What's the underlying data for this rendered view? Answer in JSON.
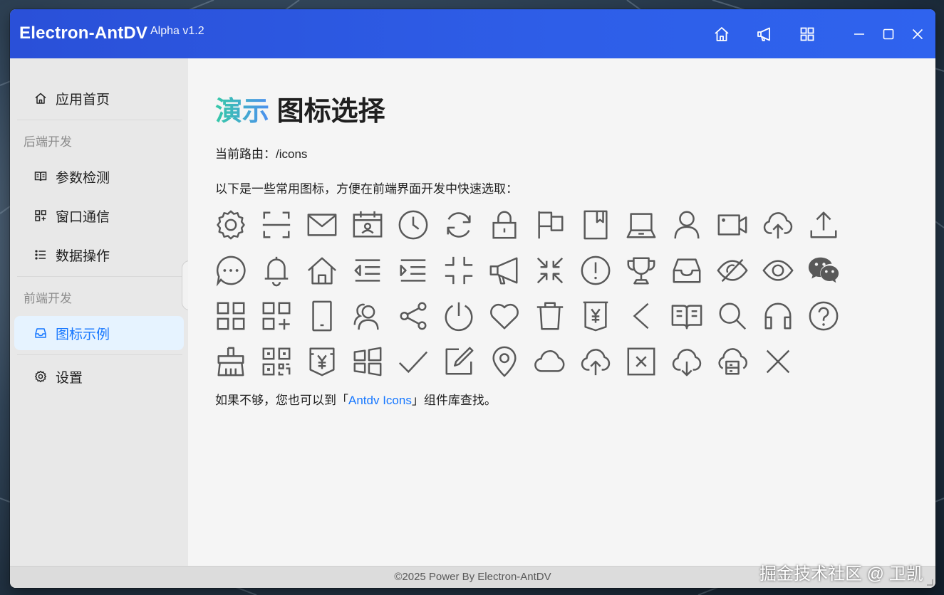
{
  "titlebar": {
    "app_title": "Electron-AntDV",
    "version": "Alpha v1.2",
    "buttons": [
      "home-icon",
      "notification-icon",
      "appstore-icon"
    ],
    "window_controls": [
      "minimize-icon",
      "maximize-icon",
      "close-icon"
    ]
  },
  "sidebar": {
    "home": "应用首页",
    "group_backend": "后端开发",
    "param_check": "参数检测",
    "window_comm": "窗口通信",
    "data_ops": "数据操作",
    "group_frontend": "前端开发",
    "icon_examples": "图标示例",
    "settings": "设置",
    "active_item": "图标示例"
  },
  "main": {
    "title_accent": "演示",
    "title_rest": "图标选择",
    "route_label": "当前路由：/icons",
    "intro": "以下是一些常用图标，方便在前端界面开发中快速选取：",
    "footer_prefix": "如果不够，您也可以到「",
    "footer_link": "Antdv Icons",
    "footer_suffix": "」组件库查找。",
    "icons": [
      [
        "setting-icon",
        "scan-icon",
        "mail-icon",
        "schedule-icon",
        "clock-icon",
        "sync-icon",
        "lock-icon",
        "flag-icon",
        "book-icon",
        "laptop-icon",
        "user-icon",
        "video-camera-icon",
        "cloud-upload-icon",
        "upload-icon"
      ],
      [
        "message-icon",
        "bell-icon",
        "home-icon",
        "menu-fold-icon",
        "menu-unfold-icon",
        "compress-icon",
        "notification-icon",
        "shrink-icon",
        "exclamation-circle-icon",
        "trophy-icon",
        "inbox-icon",
        "eye-invisible-icon",
        "eye-icon",
        "wechat-icon"
      ],
      [
        "appstore-icon",
        "appstore-add-icon",
        "mobile-icon",
        "team-icon",
        "share-icon",
        "poweroff-icon",
        "heart-icon",
        "delete-icon",
        "money-collect-icon",
        "left-icon",
        "read-icon",
        "search-icon",
        "customer-service-icon",
        "question-circle-icon"
      ],
      [
        "clear-icon",
        "qrcode-icon",
        "pay-circle-icon",
        "windows-icon",
        "check-icon",
        "form-icon",
        "environment-icon",
        "cloud-icon",
        "cloud-upload-icon",
        "close-square-icon",
        "cloud-download-icon",
        "cloud-server-icon",
        "close-icon"
      ]
    ]
  },
  "statusbar": {
    "copyright": "©2025 Power By Electron-AntDV"
  },
  "watermark": "掘金技术社区 @ 卫凯"
}
